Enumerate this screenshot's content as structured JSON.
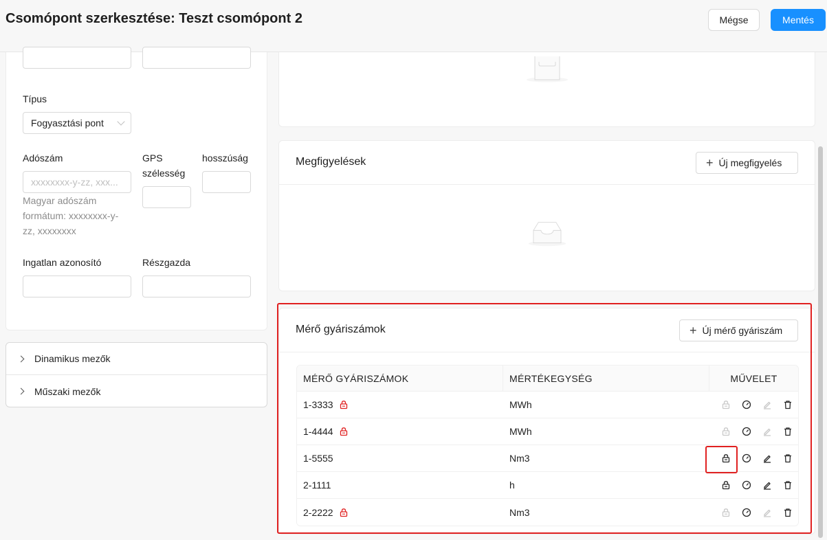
{
  "header": {
    "title": "Csomópont szerkesztése: Teszt csomópont 2",
    "cancel_label": "Mégse",
    "save_label": "Mentés"
  },
  "form": {
    "type_label": "Típus",
    "type_value": "Fogyasztási pont",
    "tax_label": "Adószám",
    "tax_placeholder": "xxxxxxxx-y-zz, xxx...",
    "tax_help": [
      "Magyar adószám",
      "formátum: xxxxxxxx-y-",
      "zz, xxxxxxxx"
    ],
    "gps_lat_label_1": "GPS",
    "gps_lat_label_2": "szélesség",
    "gps_lon_label": "hosszúság",
    "property_id_label": "Ingatlan azonosító",
    "co_owner_label": "Részgazda"
  },
  "collapse": {
    "dynamic_label": "Dinamikus mezők",
    "technical_label": "Műszaki mezők"
  },
  "observations": {
    "title": "Megfigyelések",
    "add_label": "Új megfigyelés"
  },
  "meters": {
    "title": "Mérő gyáriszámok",
    "add_label": "Új mérő gyáriszám",
    "columns": [
      "MÉRŐ GYÁRISZÁMOK",
      "MÉRTÉKEGYSÉG",
      "MŰVELET"
    ],
    "rows": [
      {
        "serial": "1-3333",
        "unit": "MWh",
        "locked": true
      },
      {
        "serial": "1-4444",
        "unit": "MWh",
        "locked": true
      },
      {
        "serial": "1-5555",
        "unit": "Nm3",
        "locked": false
      },
      {
        "serial": "2-1111",
        "unit": "h",
        "locked": false
      },
      {
        "serial": "2-2222",
        "unit": "Nm3",
        "locked": true
      }
    ]
  },
  "colors": {
    "primary": "#1890ff",
    "danger": "#e02020",
    "disabled_icon": "#c8c8c8"
  }
}
